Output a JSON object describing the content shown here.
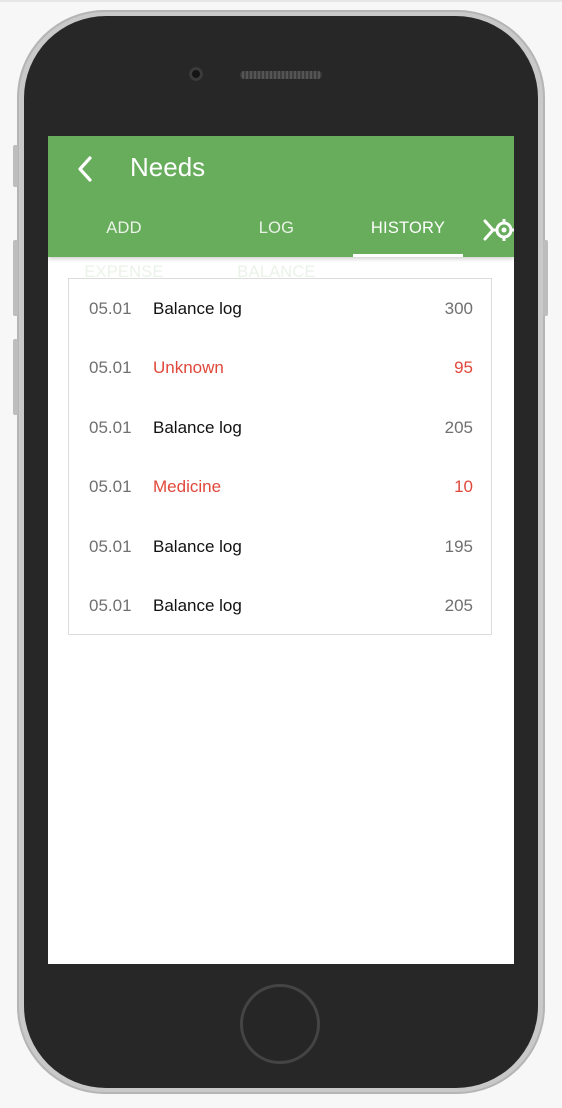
{
  "header": {
    "title": "Needs",
    "back_icon": "chevron-left-icon",
    "color": "#67ad5b"
  },
  "tabs": [
    {
      "label": "ADD EXPENSE",
      "active": false
    },
    {
      "label": "LOG BALANCE",
      "active": false
    },
    {
      "label": "HISTORY",
      "active": true
    }
  ],
  "tab_overflow_icon": "chevron-right-gear-icon",
  "history": [
    {
      "date": "05.01",
      "description": "Balance log",
      "amount": "300",
      "type": "balance"
    },
    {
      "date": "05.01",
      "description": "Unknown",
      "amount": "95",
      "type": "expense"
    },
    {
      "date": "05.01",
      "description": "Balance log",
      "amount": "205",
      "type": "balance"
    },
    {
      "date": "05.01",
      "description": "Medicine",
      "amount": "10",
      "type": "expense"
    },
    {
      "date": "05.01",
      "description": "Balance log",
      "amount": "195",
      "type": "balance"
    },
    {
      "date": "05.01",
      "description": "Balance log",
      "amount": "205",
      "type": "balance"
    }
  ],
  "colors": {
    "expense": "#e0483b",
    "muted": "#707070"
  }
}
